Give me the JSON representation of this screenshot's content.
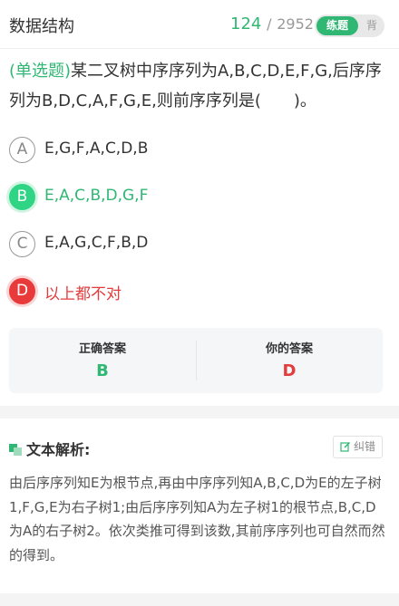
{
  "header": {
    "title": "数据结构",
    "current": "124",
    "separator": "/",
    "total": "2952",
    "mode_active": "练题",
    "mode_inactive": "背"
  },
  "question": {
    "type_label": "(单选题)",
    "text": "某二叉树中序序列为A,B,C,D,E,F,G,后序序列为B,D,C,A,F,G,E,则前序序列是(　　)。"
  },
  "options": [
    {
      "letter": "A",
      "text": "E,G,F,A,C,D,B",
      "state": "normal"
    },
    {
      "letter": "B",
      "text": "E,A,C,B,D,G,F",
      "state": "correct"
    },
    {
      "letter": "C",
      "text": "E,A,G,C,F,B,D",
      "state": "normal"
    },
    {
      "letter": "D",
      "text": "以上都不对",
      "state": "wrong"
    }
  ],
  "answers": {
    "correct_label": "正确答案",
    "correct_value": "B",
    "yours_label": "你的答案",
    "yours_value": "D"
  },
  "analysis": {
    "title": "文本解析:",
    "fix_label": "纠错",
    "body": "由后序序列知E为根节点,再由中序序列知A,B,C,D为E的左子树1,F,G,E为右子树1;由后序序列知A为左子树1的根节点,B,C,D为A的右子树2。依次类推可得到该数,其前序序列也可自然而然的得到。"
  },
  "colors": {
    "accent_green": "#2fb773",
    "error_red": "#e23c3c"
  }
}
